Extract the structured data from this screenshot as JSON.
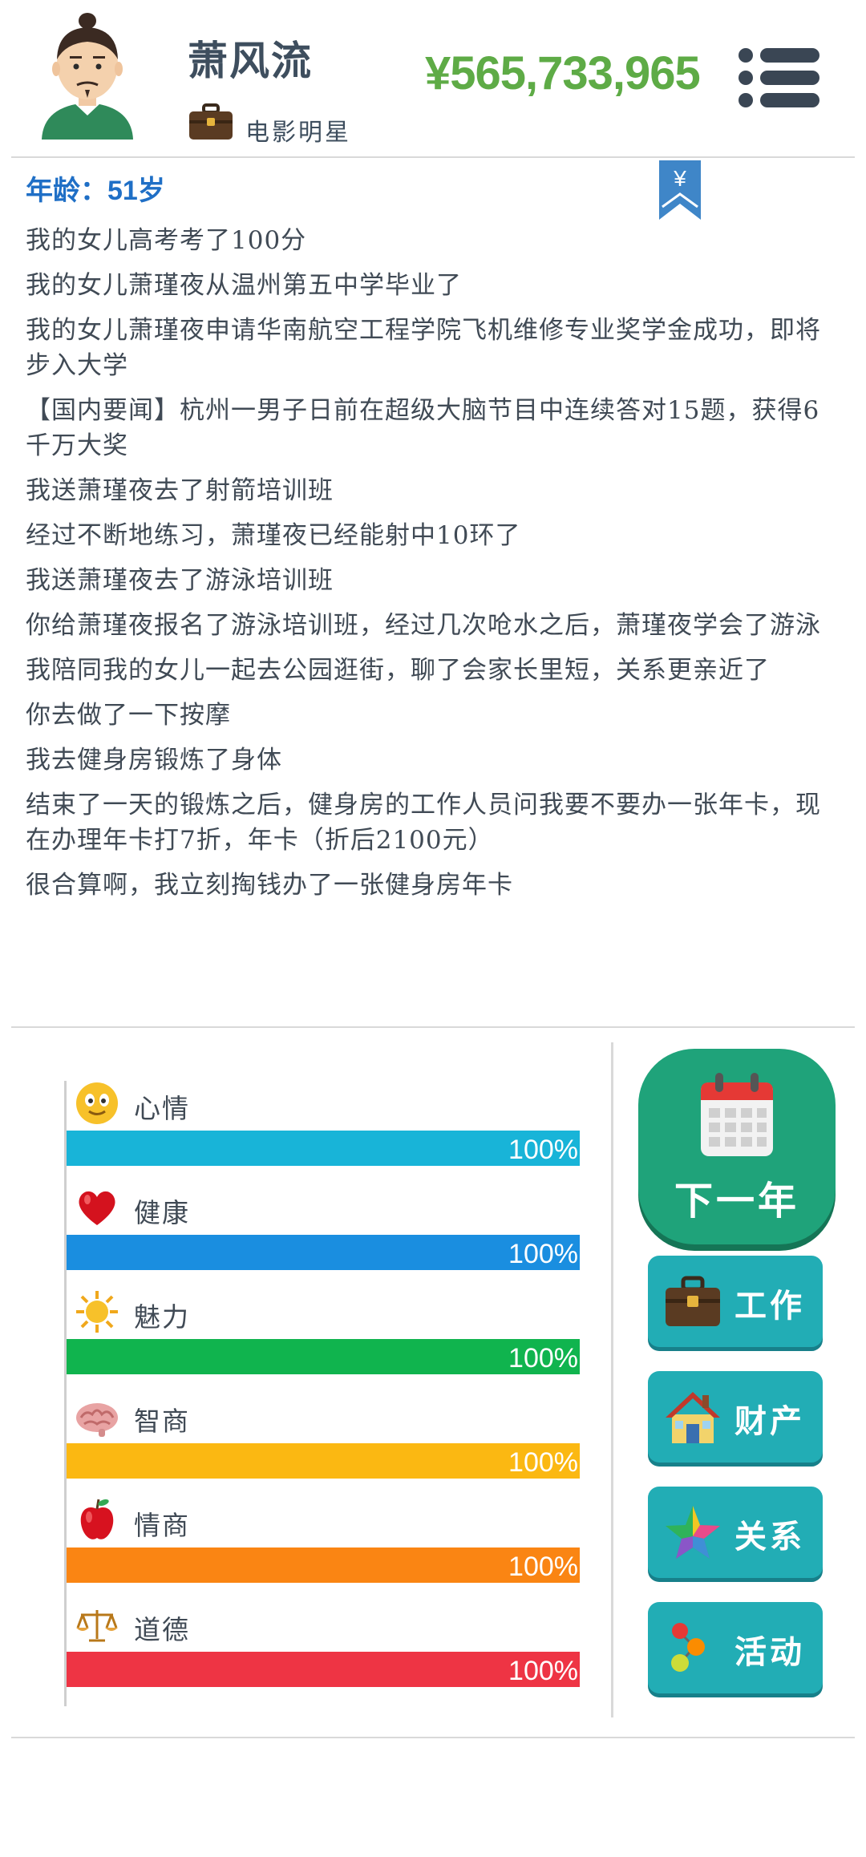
{
  "header": {
    "name": "萧风流",
    "job": "电影明星",
    "money": "¥565,733,965"
  },
  "log": {
    "age": "年龄：51岁",
    "lines": [
      "我的女儿高考考了100分",
      "我的女儿萧瑾夜从温州第五中学毕业了",
      "我的女儿萧瑾夜申请华南航空工程学院飞机维修专业奖学金成功，即将步入大学",
      "【国内要闻】杭州一男子日前在超级大脑节目中连续答对15题，获得6千万大奖",
      "我送萧瑾夜去了射箭培训班",
      "经过不断地练习，萧瑾夜已经能射中10环了",
      "我送萧瑾夜去了游泳培训班",
      "你给萧瑾夜报名了游泳培训班，经过几次呛水之后，萧瑾夜学会了游泳",
      "我陪同我的女儿一起去公园逛街，聊了会家长里短，关系更亲近了",
      "你去做了一下按摩",
      "我去健身房锻炼了身体",
      "结束了一天的锻炼之后，健身房的工作人员问我要不要办一张年卡，现在办理年卡打7折，年卡（折后2100元）",
      "很合算啊，我立刻掏钱办了一张健身房年卡"
    ]
  },
  "stats": [
    {
      "label": "心情",
      "value": "100%",
      "fraction": 1.0,
      "color": "#18b4d8",
      "icon": "smiley-icon"
    },
    {
      "label": "健康",
      "value": "100%",
      "fraction": 1.0,
      "color": "#1a8ee0",
      "icon": "heart-icon"
    },
    {
      "label": "魅力",
      "value": "100%",
      "fraction": 1.0,
      "color": "#10b44e",
      "icon": "sun-icon"
    },
    {
      "label": "智商",
      "value": "100%",
      "fraction": 1.0,
      "color": "#fbb812",
      "icon": "brain-icon"
    },
    {
      "label": "情商",
      "value": "100%",
      "fraction": 1.0,
      "color": "#fa8513",
      "icon": "apple-icon"
    },
    {
      "label": "道德",
      "value": "100%",
      "fraction": 1.0,
      "color": "#ee3444",
      "icon": "scales-icon"
    }
  ],
  "actions": {
    "next_year": "下一年",
    "work": "工作",
    "property": "财产",
    "relations": "关系",
    "activities": "活动"
  }
}
